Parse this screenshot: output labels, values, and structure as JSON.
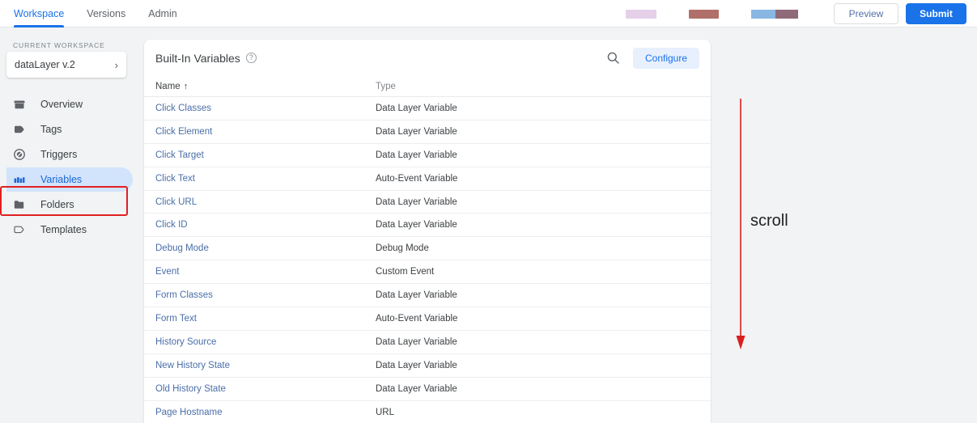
{
  "topbar": {
    "tabs": [
      {
        "label": "Workspace",
        "active": true
      },
      {
        "label": "Versions",
        "active": false
      },
      {
        "label": "Admin",
        "active": false
      }
    ],
    "preview_label": "Preview",
    "submit_label": "Submit",
    "accent_color": "#1a73e8",
    "redactions": [
      {
        "name": "redaction-block-1",
        "color": "#e5cfe9"
      },
      {
        "name": "redaction-block-2",
        "color": "#b06f68"
      },
      {
        "name": "redaction-block-3a",
        "color": "#89b6e2"
      },
      {
        "name": "redaction-block-3b",
        "color": "#8f6a78"
      }
    ]
  },
  "sidebar": {
    "workspace_caption": "CURRENT WORKSPACE",
    "workspace_name": "dataLayer v.2",
    "chevron": "›",
    "items": [
      {
        "label": "Overview",
        "icon": "archive-box-icon",
        "active": false
      },
      {
        "label": "Tags",
        "icon": "tag-icon",
        "active": false
      },
      {
        "label": "Triggers",
        "icon": "trigger-circle-icon",
        "active": false
      },
      {
        "label": "Variables",
        "icon": "variables-blocks-icon",
        "active": true
      },
      {
        "label": "Folders",
        "icon": "folder-icon",
        "active": false
      },
      {
        "label": "Templates",
        "icon": "template-outline-icon",
        "active": false
      }
    ],
    "highlight_color": "#e02020",
    "active_pill_color": "#d2e3fc"
  },
  "card": {
    "title": "Built-In Variables",
    "help_glyph": "?",
    "configure_label": "Configure",
    "columns": {
      "name": "Name",
      "sort_arrow": "↑",
      "type": "Type"
    },
    "rows": [
      {
        "name": "Click Classes",
        "type": "Data Layer Variable"
      },
      {
        "name": "Click Element",
        "type": "Data Layer Variable"
      },
      {
        "name": "Click Target",
        "type": "Data Layer Variable"
      },
      {
        "name": "Click Text",
        "type": "Auto-Event Variable"
      },
      {
        "name": "Click URL",
        "type": "Data Layer Variable"
      },
      {
        "name": "Click ID",
        "type": "Data Layer Variable"
      },
      {
        "name": "Debug Mode",
        "type": "Debug Mode"
      },
      {
        "name": "Event",
        "type": "Custom Event"
      },
      {
        "name": "Form Classes",
        "type": "Data Layer Variable"
      },
      {
        "name": "Form Text",
        "type": "Auto-Event Variable"
      },
      {
        "name": "History Source",
        "type": "Data Layer Variable"
      },
      {
        "name": "New History State",
        "type": "Data Layer Variable"
      },
      {
        "name": "Old History State",
        "type": "Data Layer Variable"
      },
      {
        "name": "Page Hostname",
        "type": "URL"
      }
    ]
  },
  "annotation": {
    "label": "scroll",
    "arrow_color": "#d81f1f",
    "direction": "down"
  }
}
